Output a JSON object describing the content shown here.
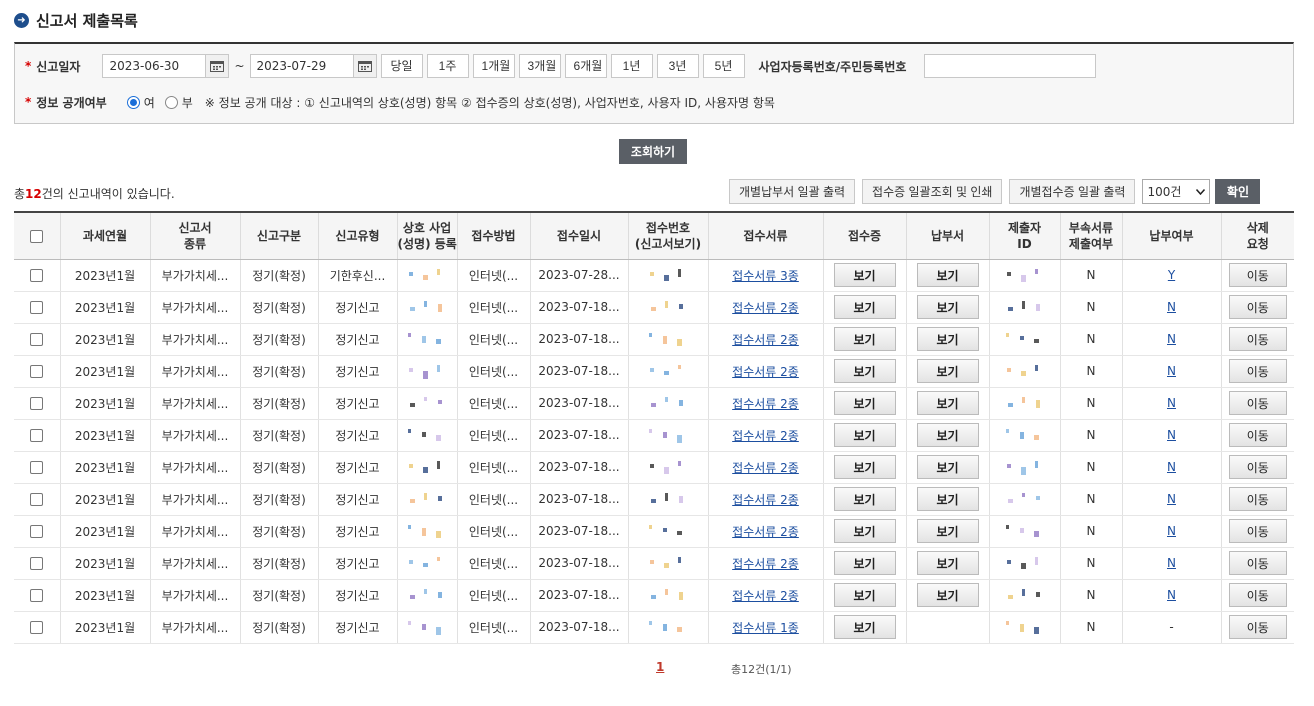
{
  "page_title": "신고서 제출목록",
  "search": {
    "date_label": "신고일자",
    "date_from": "2023-06-30",
    "date_to": "2023-07-29",
    "tilde": "~",
    "period_buttons": [
      "당일",
      "1주",
      "1개월",
      "3개월",
      "6개월",
      "1년",
      "3년",
      "5년"
    ],
    "biz_label": "사업자등록번호/주민등록번호",
    "biz_value": "",
    "disclose_label": "정보 공개여부",
    "radio_yes": "여",
    "radio_no": "부",
    "radio_selected": "여",
    "note": "※ 정보 공개 대상 : ① 신고내역의 상호(성명) 항목 ② 접수증의 상호(성명), 사업자번호, 사용자 ID, 사용자명 항목",
    "search_button": "조회하기"
  },
  "summary": {
    "prefix": "총",
    "count": "12",
    "suffix": "건의 신고내역이 있습니다."
  },
  "toolbar": {
    "btn_payslip": "개별납부서 일괄 출력",
    "btn_receipt_print": "접수증 일괄조회 및 인쇄",
    "btn_receipt_each": "개별접수증 일괄 출력",
    "page_size": "100건",
    "confirm": "확인"
  },
  "table": {
    "headers": {
      "period": "과세연월",
      "kind_1": "신고서",
      "kind_2": "종류",
      "category": "신고구분",
      "type": "신고유형",
      "name_1": "상호 사업",
      "name_2": "(성명) 등록",
      "method": "접수방법",
      "date": "접수일시",
      "receipt_no_1": "접수번호",
      "receipt_no_2": "(신고서보기)",
      "docs": "접수서류",
      "receipt": "접수증",
      "payslip": "납부서",
      "submitter_1": "제출자",
      "submitter_2": "ID",
      "attach_1": "부속서류",
      "attach_2": "제출여부",
      "paid": "납부여부",
      "delete_1": "삭제",
      "delete_2": "요청"
    },
    "rows": [
      {
        "period": "2023년1월",
        "kind": "부가가치세...",
        "category": "정기(확정)",
        "type": "기한후신...",
        "method": "인터넷(...",
        "date": "2023-07-28...",
        "docs": "접수서류 3종",
        "receipt": "보기",
        "payslip": "보기",
        "attach": "N",
        "paid": "Y",
        "delete": "이동"
      },
      {
        "period": "2023년1월",
        "kind": "부가가치세...",
        "category": "정기(확정)",
        "type": "정기신고",
        "method": "인터넷(...",
        "date": "2023-07-18...",
        "docs": "접수서류 2종",
        "receipt": "보기",
        "payslip": "보기",
        "attach": "N",
        "paid": "N",
        "delete": "이동"
      },
      {
        "period": "2023년1월",
        "kind": "부가가치세...",
        "category": "정기(확정)",
        "type": "정기신고",
        "method": "인터넷(...",
        "date": "2023-07-18...",
        "docs": "접수서류 2종",
        "receipt": "보기",
        "payslip": "보기",
        "attach": "N",
        "paid": "N",
        "delete": "이동"
      },
      {
        "period": "2023년1월",
        "kind": "부가가치세...",
        "category": "정기(확정)",
        "type": "정기신고",
        "method": "인터넷(...",
        "date": "2023-07-18...",
        "docs": "접수서류 2종",
        "receipt": "보기",
        "payslip": "보기",
        "attach": "N",
        "paid": "N",
        "delete": "이동"
      },
      {
        "period": "2023년1월",
        "kind": "부가가치세...",
        "category": "정기(확정)",
        "type": "정기신고",
        "method": "인터넷(...",
        "date": "2023-07-18...",
        "docs": "접수서류 2종",
        "receipt": "보기",
        "payslip": "보기",
        "attach": "N",
        "paid": "N",
        "delete": "이동"
      },
      {
        "period": "2023년1월",
        "kind": "부가가치세...",
        "category": "정기(확정)",
        "type": "정기신고",
        "method": "인터넷(...",
        "date": "2023-07-18...",
        "docs": "접수서류 2종",
        "receipt": "보기",
        "payslip": "보기",
        "attach": "N",
        "paid": "N",
        "delete": "이동"
      },
      {
        "period": "2023년1월",
        "kind": "부가가치세...",
        "category": "정기(확정)",
        "type": "정기신고",
        "method": "인터넷(...",
        "date": "2023-07-18...",
        "docs": "접수서류 2종",
        "receipt": "보기",
        "payslip": "보기",
        "attach": "N",
        "paid": "N",
        "delete": "이동"
      },
      {
        "period": "2023년1월",
        "kind": "부가가치세...",
        "category": "정기(확정)",
        "type": "정기신고",
        "method": "인터넷(...",
        "date": "2023-07-18...",
        "docs": "접수서류 2종",
        "receipt": "보기",
        "payslip": "보기",
        "attach": "N",
        "paid": "N",
        "delete": "이동"
      },
      {
        "period": "2023년1월",
        "kind": "부가가치세...",
        "category": "정기(확정)",
        "type": "정기신고",
        "method": "인터넷(...",
        "date": "2023-07-18...",
        "docs": "접수서류 2종",
        "receipt": "보기",
        "payslip": "보기",
        "attach": "N",
        "paid": "N",
        "delete": "이동"
      },
      {
        "period": "2023년1월",
        "kind": "부가가치세...",
        "category": "정기(확정)",
        "type": "정기신고",
        "method": "인터넷(...",
        "date": "2023-07-18...",
        "docs": "접수서류 2종",
        "receipt": "보기",
        "payslip": "보기",
        "attach": "N",
        "paid": "N",
        "delete": "이동"
      },
      {
        "period": "2023년1월",
        "kind": "부가가치세...",
        "category": "정기(확정)",
        "type": "정기신고",
        "method": "인터넷(...",
        "date": "2023-07-18...",
        "docs": "접수서류 2종",
        "receipt": "보기",
        "payslip": "보기",
        "attach": "N",
        "paid": "N",
        "delete": "이동"
      },
      {
        "period": "2023년1월",
        "kind": "부가가치세...",
        "category": "정기(확정)",
        "type": "정기신고",
        "method": "인터넷(...",
        "date": "2023-07-18...",
        "docs": "접수서류 1종",
        "receipt": "보기",
        "payslip": "",
        "attach": "N",
        "paid": "-",
        "delete": "이동"
      }
    ]
  },
  "pagination": {
    "current": "1",
    "info": "총12건(1/1)"
  },
  "colors": {
    "accent_dark": "#5a5f66",
    "link": "#1d4fa0",
    "required": "#d60000",
    "title_icon": "#1e4e8c"
  },
  "icons": {
    "title": "arrow-circle-icon",
    "calendar": "calendar-icon",
    "select": "chevron-down-icon"
  }
}
